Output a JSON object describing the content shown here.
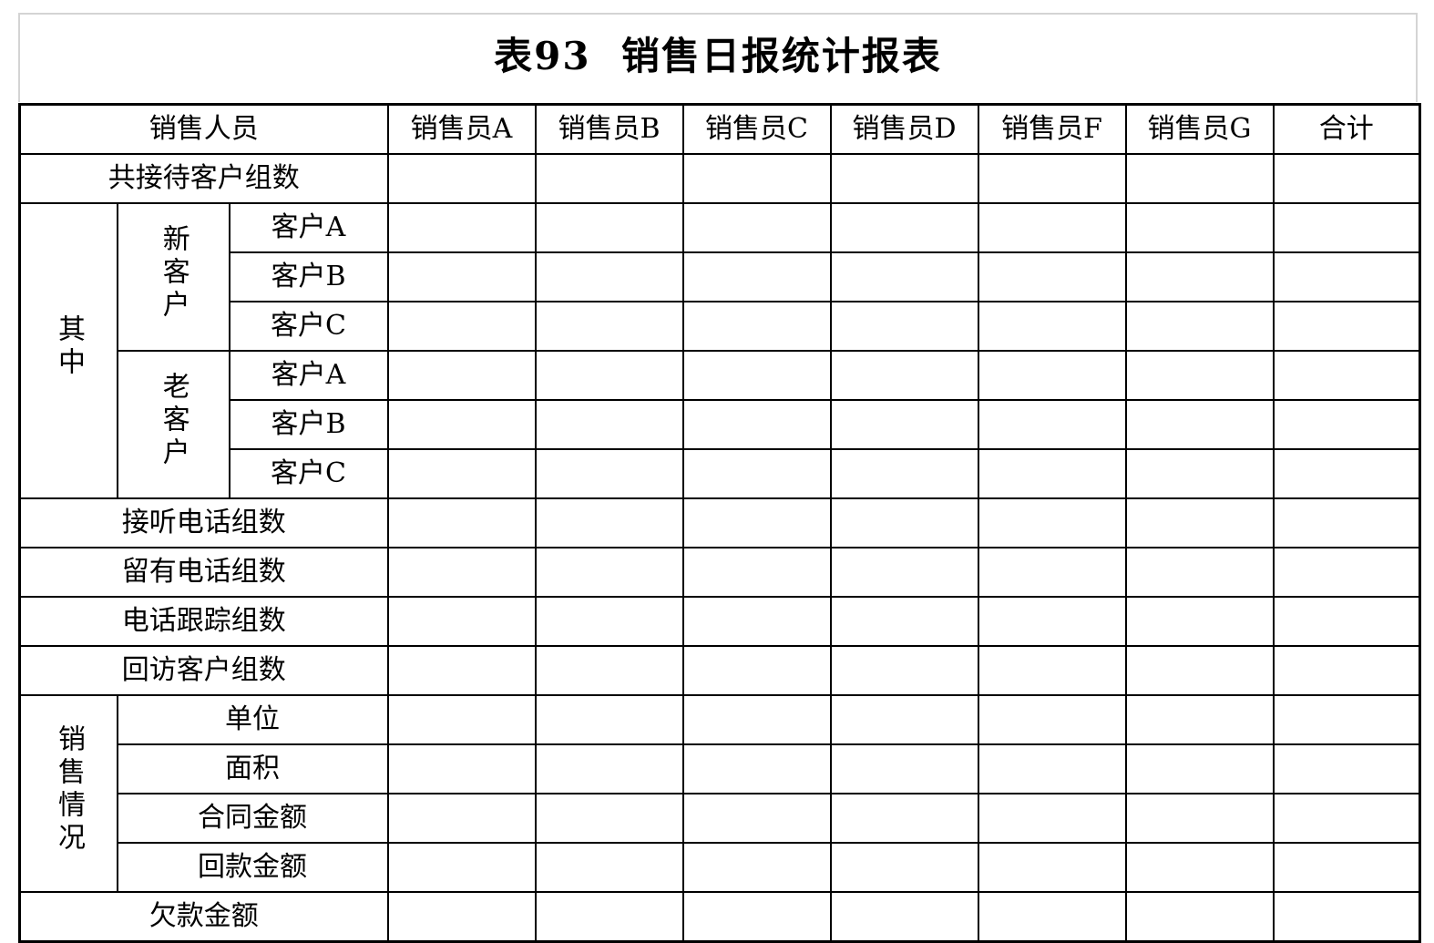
{
  "document": {
    "title": "表93  销售日报统计报表",
    "title_number": "表93",
    "title_name": "销售日报统计报表"
  },
  "table": {
    "row_header_label": "销售人员",
    "columns": [
      "销售员A",
      "销售员B",
      "销售员C",
      "销售员D",
      "销售员F",
      "销售员G",
      "合计"
    ],
    "groups": {
      "qizhong": "其中",
      "new_customer": "新客户",
      "old_customer": "老客户",
      "sales_status": "销售情况"
    },
    "rows": [
      {
        "label": "共接待客户组数",
        "span": "full"
      },
      {
        "group": "其中",
        "sub": "新客户",
        "label": "客户A"
      },
      {
        "group": "其中",
        "sub": "新客户",
        "label": "客户B"
      },
      {
        "group": "其中",
        "sub": "新客户",
        "label": "客户C"
      },
      {
        "group": "其中",
        "sub": "老客户",
        "label": "客户A"
      },
      {
        "group": "其中",
        "sub": "老客户",
        "label": "客户B"
      },
      {
        "group": "其中",
        "sub": "老客户",
        "label": "客户C"
      },
      {
        "label": "接听电话组数",
        "span": "full"
      },
      {
        "label": "留有电话组数",
        "span": "full"
      },
      {
        "label": "电话跟踪组数",
        "span": "full"
      },
      {
        "label": "回访客户组数",
        "span": "full"
      },
      {
        "group": "销售情况",
        "label": "单位"
      },
      {
        "group": "销售情况",
        "label": "面积"
      },
      {
        "group": "销售情况",
        "label": "合同金额"
      },
      {
        "group": "销售情况",
        "label": "回款金额"
      },
      {
        "label": "欠款金额",
        "span": "full"
      }
    ],
    "values": {
      "empty": ""
    },
    "colors": {
      "grid": "#000000",
      "title_border": "#d4d4d4",
      "background": "#ffffff",
      "text": "#000000"
    }
  }
}
